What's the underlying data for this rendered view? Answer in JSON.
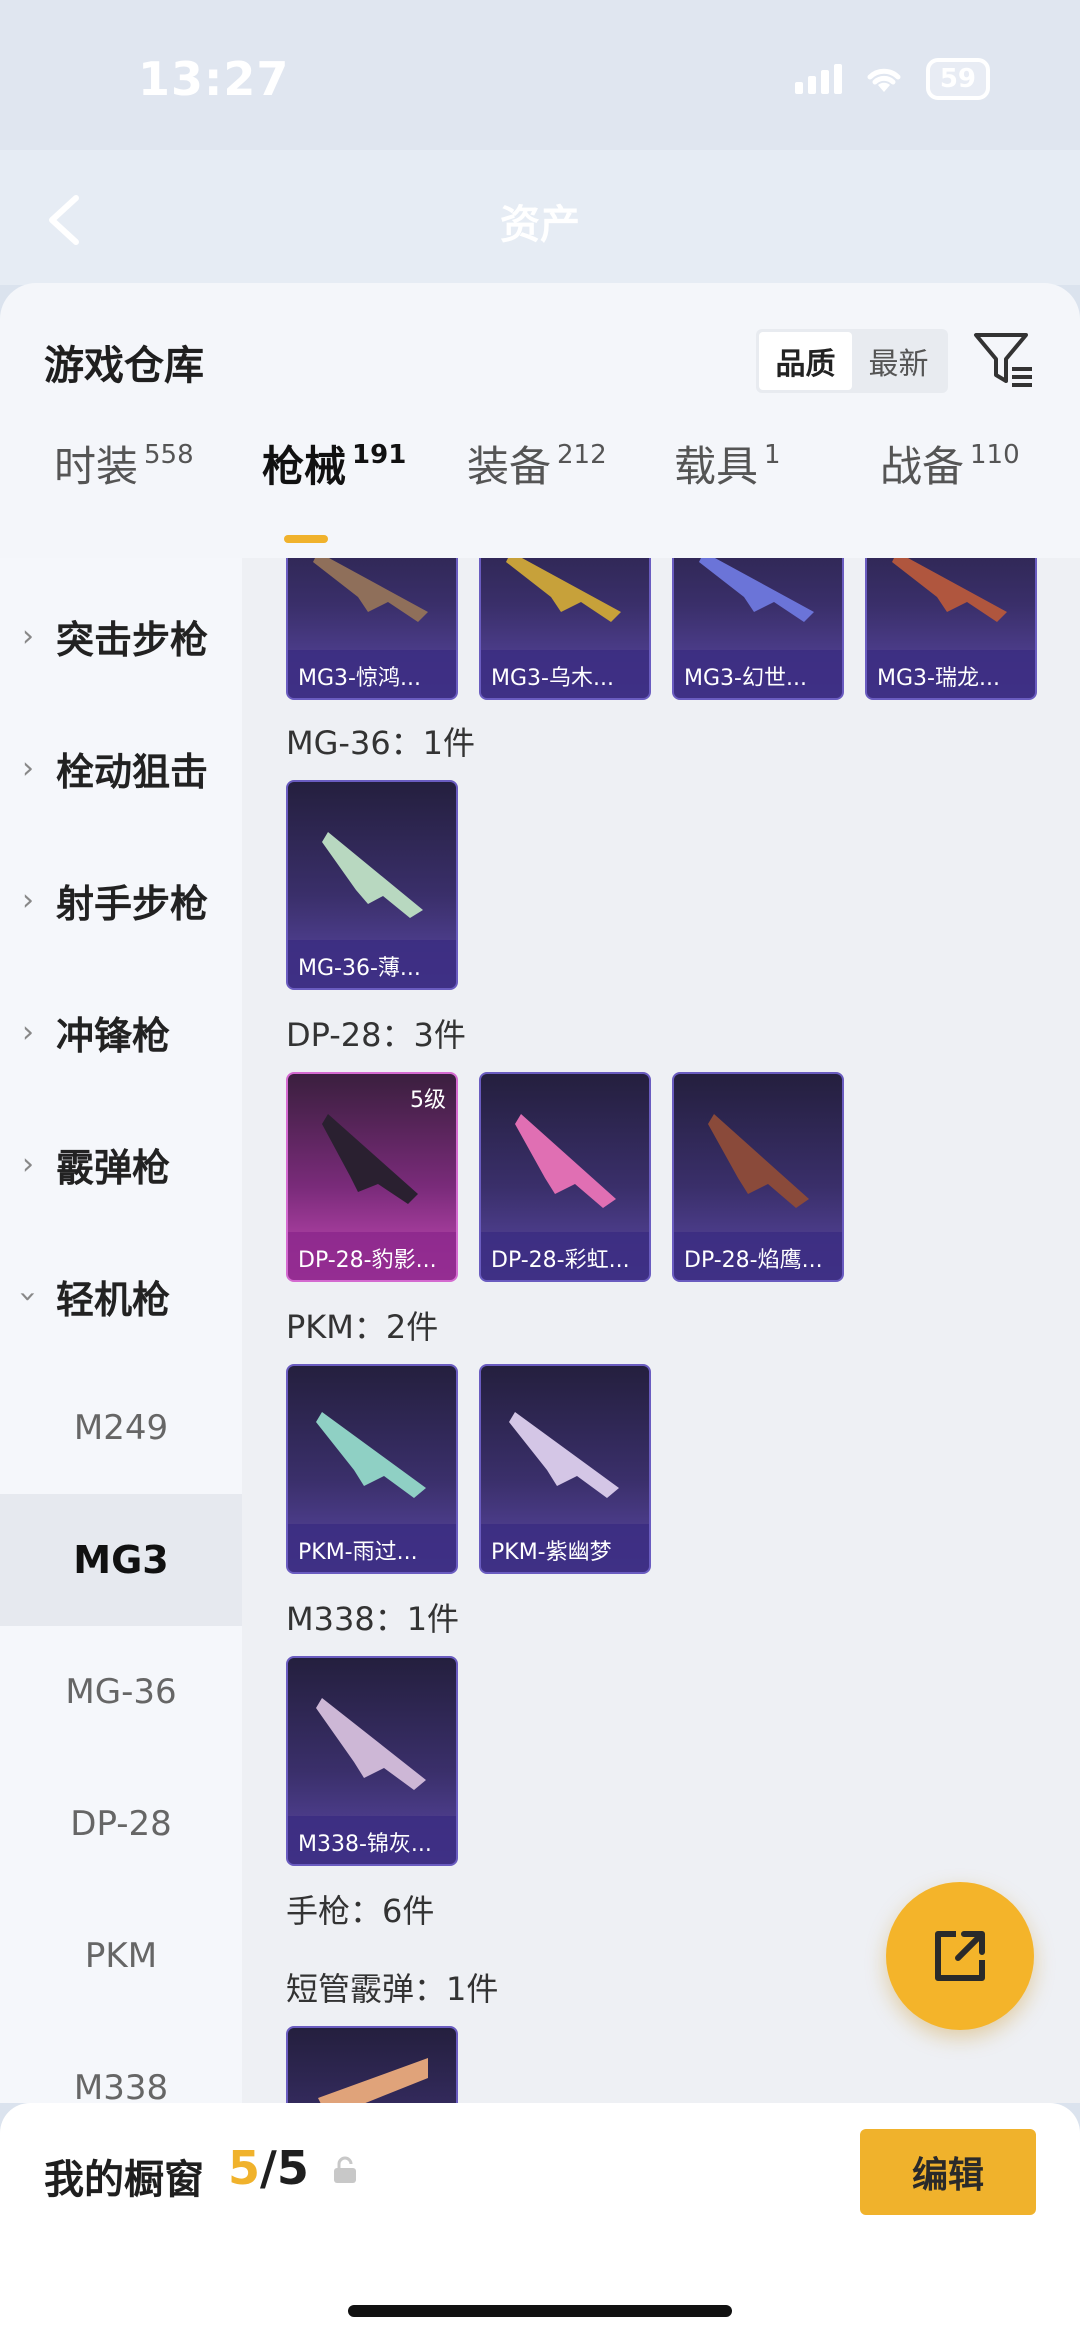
{
  "status": {
    "time": "13:27",
    "battery": "59"
  },
  "nav": {
    "title": "资产"
  },
  "sheet": {
    "title": "游戏仓库",
    "sort": [
      "品质",
      "最新"
    ],
    "tabs": [
      {
        "label": "时装",
        "count": "558"
      },
      {
        "label": "枪械",
        "count": "191"
      },
      {
        "label": "装备",
        "count": "212"
      },
      {
        "label": "载具",
        "count": "1"
      },
      {
        "label": "战备",
        "count": "110"
      }
    ]
  },
  "sidebar": {
    "categories": [
      "突击步枪",
      "栓动狙击",
      "射手步枪",
      "冲锋枪",
      "霰弹枪",
      "轻机枪"
    ],
    "sub": [
      "M249",
      "MG3",
      "MG-36",
      "DP-28",
      "PKM",
      "M338"
    ]
  },
  "content": {
    "mg3_cards": [
      "MG3-惊鸿...",
      "MG3-乌木...",
      "MG3-幻世...",
      "MG3-瑞龙..."
    ],
    "groups": [
      {
        "label": "MG-36：1件",
        "cards": [
          "MG-36-薄..."
        ]
      },
      {
        "label": "DP-28：3件",
        "cards": [
          "DP-28-豹影...",
          "DP-28-彩虹...",
          "DP-28-焰鹰..."
        ],
        "level_badge": "5级"
      },
      {
        "label": "PKM：2件",
        "cards": [
          "PKM-雨过...",
          "PKM-紫幽梦"
        ]
      },
      {
        "label": "M338：1件",
        "cards": [
          "M338-锦灰..."
        ]
      },
      {
        "label": "手枪：6件"
      },
      {
        "label": "短管霰弹：1件"
      }
    ]
  },
  "bottom": {
    "title": "我的橱窗",
    "count_current": "5",
    "count_rest": "/5",
    "edit": "编辑"
  },
  "colors": {
    "accent": "#f0b22c",
    "card_purple": "#5b48a6",
    "card_pink": "#c84bb8"
  }
}
